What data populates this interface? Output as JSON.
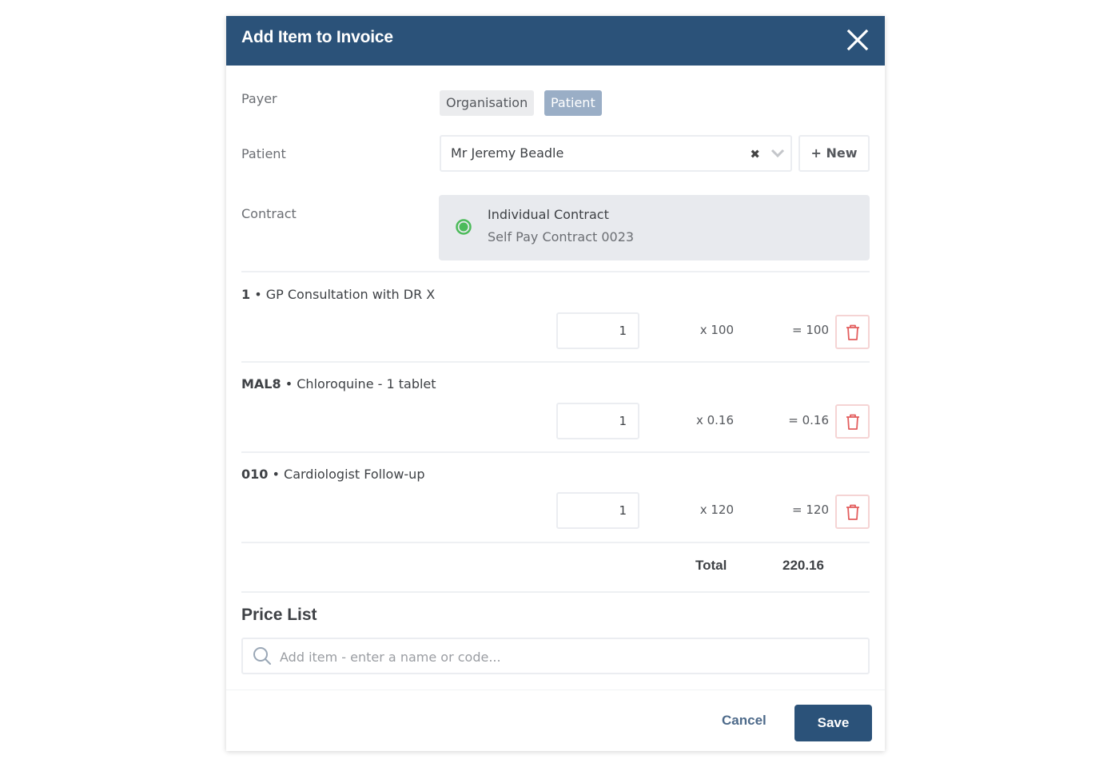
{
  "dialog": {
    "title": "Add Item to Invoice",
    "close_icon": "close-icon"
  },
  "colors": {
    "header_bg": "#2b5279",
    "primary": "#2b5279",
    "segment_selected": "#9aaec6",
    "delete_icon": "#e35d5d",
    "contract_status": "#4cbb5a"
  },
  "form": {
    "payer": {
      "label": "Payer",
      "options": [
        "Organisation",
        "Patient"
      ],
      "selected": "Patient"
    },
    "patient": {
      "label": "Patient",
      "value": "Mr Jeremy Beadle",
      "clear_symbol": "✖",
      "new_button": "+ New"
    },
    "contract": {
      "label": "Contract",
      "name": "Individual Contract",
      "subtitle": "Self Pay Contract 0023"
    }
  },
  "items": [
    {
      "code": "1",
      "name": "GP Consultation with DR X",
      "quantity": "1",
      "unit_price": "x 100",
      "line_total": "= 100"
    },
    {
      "code": "MAL8",
      "name": "Chloroquine - 1 tablet",
      "quantity": "1",
      "unit_price": "x 0.16",
      "line_total": "= 0.16"
    },
    {
      "code": "010",
      "name": "Cardiologist Follow-up",
      "quantity": "1",
      "unit_price": "x 120",
      "line_total": "= 120"
    }
  ],
  "separator": " • ",
  "total": {
    "label": "Total",
    "value": "220.16"
  },
  "price_list": {
    "title": "Price List",
    "placeholder": "Add item - enter a name or code...",
    "value": ""
  },
  "footer": {
    "cancel": "Cancel",
    "save": "Save"
  }
}
